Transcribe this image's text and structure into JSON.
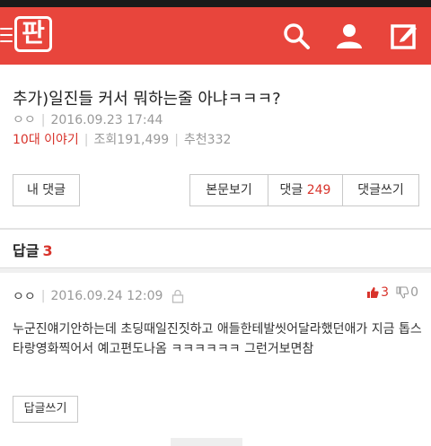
{
  "app": {
    "logo_text": "판",
    "brand_color": "#e8453c",
    "icons": [
      "menu-icon",
      "search-icon",
      "user-icon",
      "write-icon"
    ]
  },
  "post": {
    "title": "추가)일진들 커서 뭐하는줄 아냐ㅋㅋㅋ?",
    "author": "ㅇㅇ",
    "date": "2016.09.23 17:44",
    "category": "10대 이야기",
    "views_label": "조회",
    "views": "191,499",
    "recommend_label": "추천",
    "recommend": "332"
  },
  "actions": {
    "my_comments": "내 댓글",
    "view_post": "본문보기",
    "comments_label": "댓글",
    "comments_count": "249",
    "write_comment": "댓글쓰기"
  },
  "replies": {
    "label": "답글",
    "count": "3"
  },
  "comment": {
    "author": "ㅇㅇ",
    "date": "2016.09.24 12:09",
    "upvotes": "3",
    "downvotes": "0",
    "body": "누군진얘기안하는데 초딩때일진짓하고 애들한테발씻어달라했던애가 지금 톱스타랑영화찍어서 예고편도나옴 ㅋㅋㅋㅋㅋㅋ 그런거보면참",
    "reply_button": "답글쓰기"
  }
}
